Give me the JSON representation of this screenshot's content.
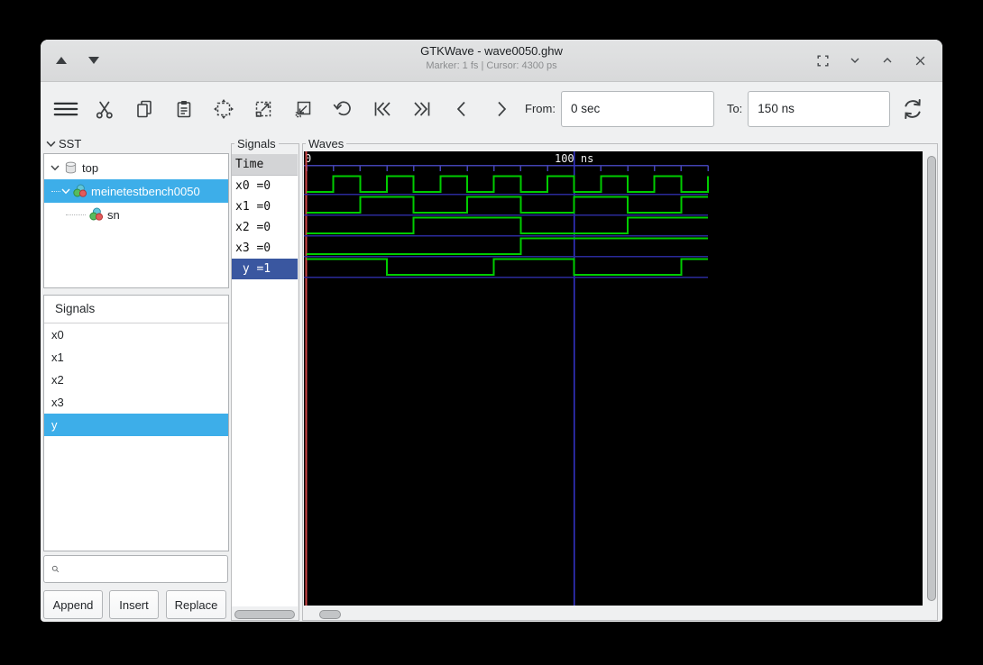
{
  "titlebar": {
    "title": "GTKWave - wave0050.ghw",
    "subtitle": "Marker: 1 fs  |  Cursor: 4300 ps",
    "icons": [
      "shade-up",
      "shade-down",
      "fullscreen",
      "roll-down",
      "roll-up",
      "close"
    ]
  },
  "toolbar": {
    "icons": [
      "menu",
      "cut",
      "copy",
      "paste",
      "zoom-fit",
      "zoom-in",
      "zoom-out",
      "undo",
      "shift-to-start",
      "shift-to-end",
      "shift-left",
      "shift-right",
      "reload"
    ],
    "from_label": "From:",
    "from_value": "0 sec",
    "to_label": "To:",
    "to_value": "150 ns"
  },
  "sst": {
    "header": "SST",
    "tree": [
      {
        "label": "top",
        "icon": "hierarchy-root",
        "expanded": true,
        "selected": false
      },
      {
        "label": "meinetestbench0050",
        "icon": "module",
        "expanded": true,
        "selected": true
      },
      {
        "label": "sn",
        "icon": "module",
        "expanded": false,
        "selected": false
      }
    ],
    "signals_header": "Signals",
    "signal_items": [
      {
        "label": "x0",
        "selected": false
      },
      {
        "label": "x1",
        "selected": false
      },
      {
        "label": "x2",
        "selected": false
      },
      {
        "label": "x3",
        "selected": false
      },
      {
        "label": "y",
        "selected": true
      }
    ],
    "search_value": "",
    "buttons": [
      {
        "label": "Append"
      },
      {
        "label": "Insert"
      },
      {
        "label": "Replace"
      }
    ]
  },
  "signals_panel": {
    "frame_label": "Signals",
    "time_header": "Time"
  },
  "waves": {
    "frame_label": "Waves",
    "chart_data": {
      "type": "digital_timing_waveform",
      "time_unit": "ns",
      "x_range_ns": [
        0,
        150
      ],
      "tick_interval_ns": 10,
      "tick_labels": [
        {
          "t_ns": 0,
          "label": "0"
        },
        {
          "t_ns": 100,
          "label": "100 ns"
        }
      ],
      "marker_line_t_ns": 0,
      "cursor_line_t_ns": 100,
      "signals": [
        {
          "name": "x0",
          "value_at_marker": "0",
          "display": "x0 =0",
          "selected": false,
          "high_intervals_ns": [
            [
              10,
              20
            ],
            [
              30,
              40
            ],
            [
              50,
              60
            ],
            [
              70,
              80
            ],
            [
              90,
              100
            ],
            [
              110,
              120
            ],
            [
              130,
              140
            ]
          ],
          "end_edge": "rise"
        },
        {
          "name": "x1",
          "value_at_marker": "0",
          "display": "x1 =0",
          "selected": false,
          "high_intervals_ns": [
            [
              20,
              40
            ],
            [
              60,
              80
            ],
            [
              100,
              120
            ],
            [
              140,
              150
            ]
          ]
        },
        {
          "name": "x2",
          "value_at_marker": "0",
          "display": "x2 =0",
          "selected": false,
          "high_intervals_ns": [
            [
              40,
              80
            ],
            [
              120,
              150
            ]
          ]
        },
        {
          "name": "x3",
          "value_at_marker": "0",
          "display": "x3 =0",
          "selected": false,
          "high_intervals_ns": [
            [
              80,
              150
            ]
          ]
        },
        {
          "name": "y",
          "value_at_marker": "1",
          "display": " y =1",
          "selected": true,
          "high_intervals_ns": [
            [
              0,
              30
            ],
            [
              70,
              100
            ],
            [
              140,
              150
            ]
          ]
        }
      ],
      "colors": {
        "wave": "#00cc00",
        "baseline": "#2a2a9a",
        "ruler": "#4242b0",
        "cursor": "#3535cd",
        "marker": "#cc4545",
        "background": "#000000",
        "selected_name_row_bg": "#3a57a0"
      }
    }
  }
}
